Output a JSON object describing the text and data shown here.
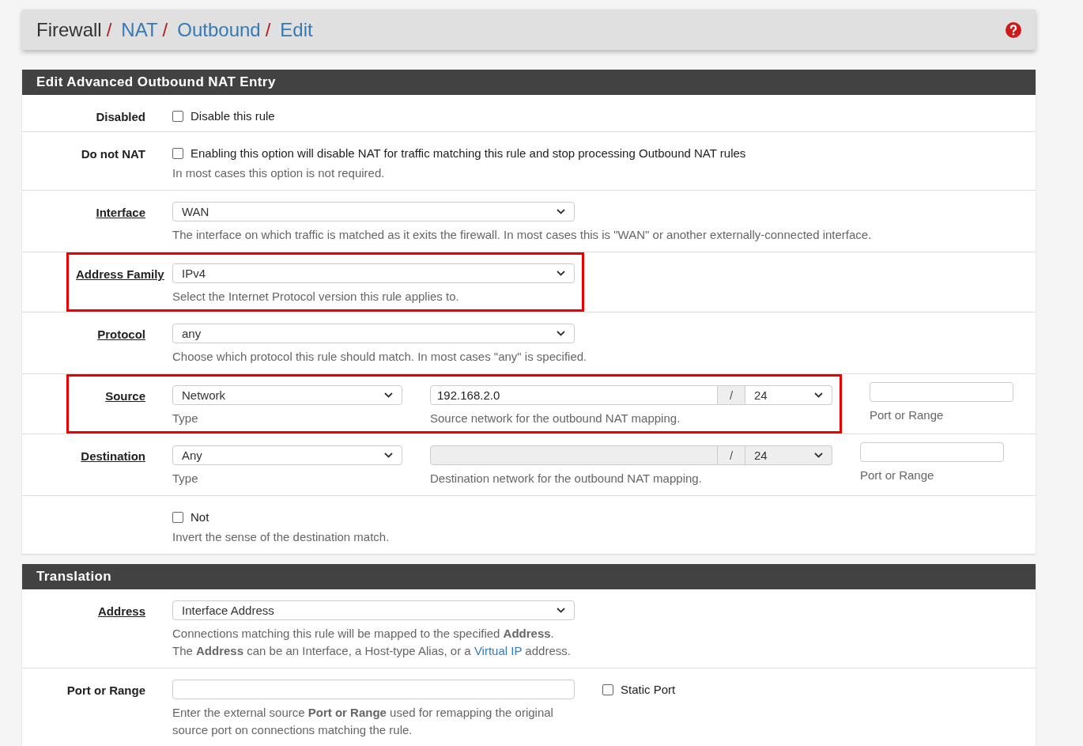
{
  "breadcrumb": [
    {
      "label": "Firewall",
      "link": false,
      "separator": "/"
    },
    {
      "label": "NAT",
      "link": true,
      "separator": "/"
    },
    {
      "label": "Outbound",
      "link": true,
      "separator": "/"
    },
    {
      "label": "Edit",
      "link": true
    }
  ],
  "sections": [
    {
      "title": "Edit Advanced Outbound NAT Entry",
      "rows": [
        {
          "kind": "checkbox",
          "label": "Disabled",
          "label_link": false,
          "highlighted": false,
          "checked": false,
          "text": "Disable this rule"
        },
        {
          "kind": "checkbox",
          "label": "Do not NAT",
          "label_link": false,
          "highlighted": false,
          "checked": false,
          "text": "Enabling this option will disable NAT for traffic matching this rule and stop processing Outbound NAT rules",
          "help": "In most cases this option is not required."
        },
        {
          "kind": "select",
          "label": "Interface",
          "label_link": true,
          "highlighted": false,
          "value": "WAN",
          "help": "The interface on which traffic is matched as it exits the firewall. In most cases this is \"WAN\" or another externally-connected interface."
        },
        {
          "kind": "select",
          "label": "Address Family",
          "label_link": true,
          "highlighted": true,
          "value": "IPv4",
          "help": "Select the Internet Protocol version this rule applies to."
        },
        {
          "kind": "select",
          "label": "Protocol",
          "label_link": true,
          "highlighted": false,
          "value": "any",
          "help": "Choose which protocol this rule should match. In most cases \"any\" is specified."
        },
        {
          "kind": "network",
          "label": "Source",
          "label_link": true,
          "highlighted": true,
          "type": "Network",
          "type_help": "Type",
          "address": "192.168.2.0",
          "disabled": false,
          "separator": "/",
          "mask": "24",
          "network_help": "Source network for the outbound NAT mapping.",
          "port_help": "Port or Range"
        },
        {
          "kind": "network",
          "label": "Destination",
          "label_link": true,
          "highlighted": false,
          "type": "Any",
          "type_help": "Type",
          "disabled": true,
          "separator": "/",
          "mask": "24",
          "network_help": "Destination network for the outbound NAT mapping.",
          "port_help": "Port or Range"
        },
        {
          "kind": "checkbox",
          "highlighted": false,
          "checked": false,
          "text": "Not",
          "help": "Invert the sense of the destination match."
        }
      ]
    },
    {
      "title": "Translation",
      "rows": [
        {
          "kind": "select",
          "label": "Address",
          "label_link": true,
          "highlighted": false,
          "value": "Interface Address",
          "help_lines": [
            [
              {
                "kind": "text",
                "text": "Connections matching this rule will be mapped to the specified **Address**."
              }
            ],
            [
              {
                "kind": "text",
                "text": "The **Address** can be an Interface, a Host-type Alias, or a "
              },
              {
                "kind": "link",
                "text": "Virtual IP"
              },
              {
                "kind": "text",
                "text": " address."
              }
            ]
          ]
        },
        {
          "kind": "port",
          "label": "Port or Range",
          "label_link": false,
          "highlighted": false,
          "checked": false,
          "text": "Static Port",
          "help": "Enter the external source **Port or Range** used for remapping the original source port on connections matching the rule."
        }
      ]
    }
  ]
}
